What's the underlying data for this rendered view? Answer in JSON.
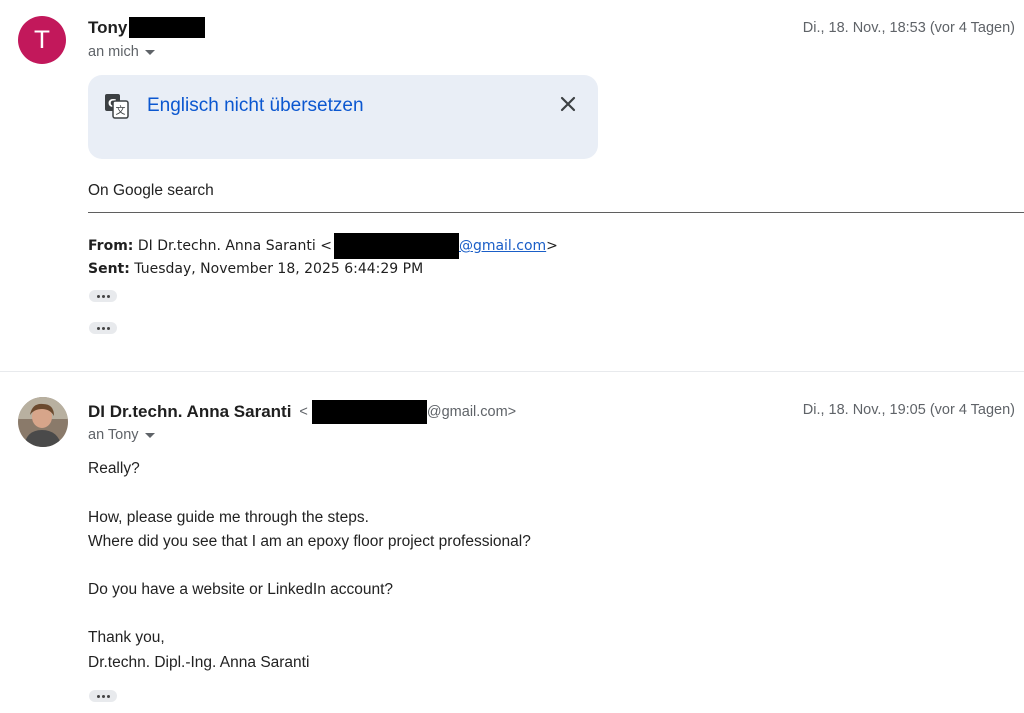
{
  "message1": {
    "avatar_letter": "T",
    "avatar_color": "#c2185b",
    "sender_name": "Tony",
    "date": "Di., 18. Nov., 18:53 (vor 4 Tagen)",
    "recipient": "an mich",
    "translate_label": "Englisch nicht übersetzen",
    "body": "On Google search",
    "forward": {
      "from_label": "From:",
      "from_name": "DI Dr.techn. Anna Saranti <",
      "from_email_domain": "@gmail.com",
      "from_end": ">",
      "sent_label": "Sent:",
      "sent_value": "Tuesday, November 18, 2025 6:44:29 PM"
    }
  },
  "message2": {
    "sender_name": "DI Dr.techn. Anna Saranti",
    "email_open": "<",
    "email_domain": "@gmail.com>",
    "date": "Di., 18. Nov., 19:05 (vor 4 Tagen)",
    "recipient": "an Tony",
    "body_lines": [
      "Really?",
      "How, please guide me through the steps.",
      "Where did you see that I am an epoxy floor project professional?",
      "Do you have a website or LinkedIn account?",
      "Thank you,",
      "Dr.techn. Dipl.-Ing. Anna Saranti"
    ]
  },
  "colors": {
    "link_blue": "#0b57d0",
    "translate_bg": "#e9eef6",
    "redaction": "#000000"
  }
}
